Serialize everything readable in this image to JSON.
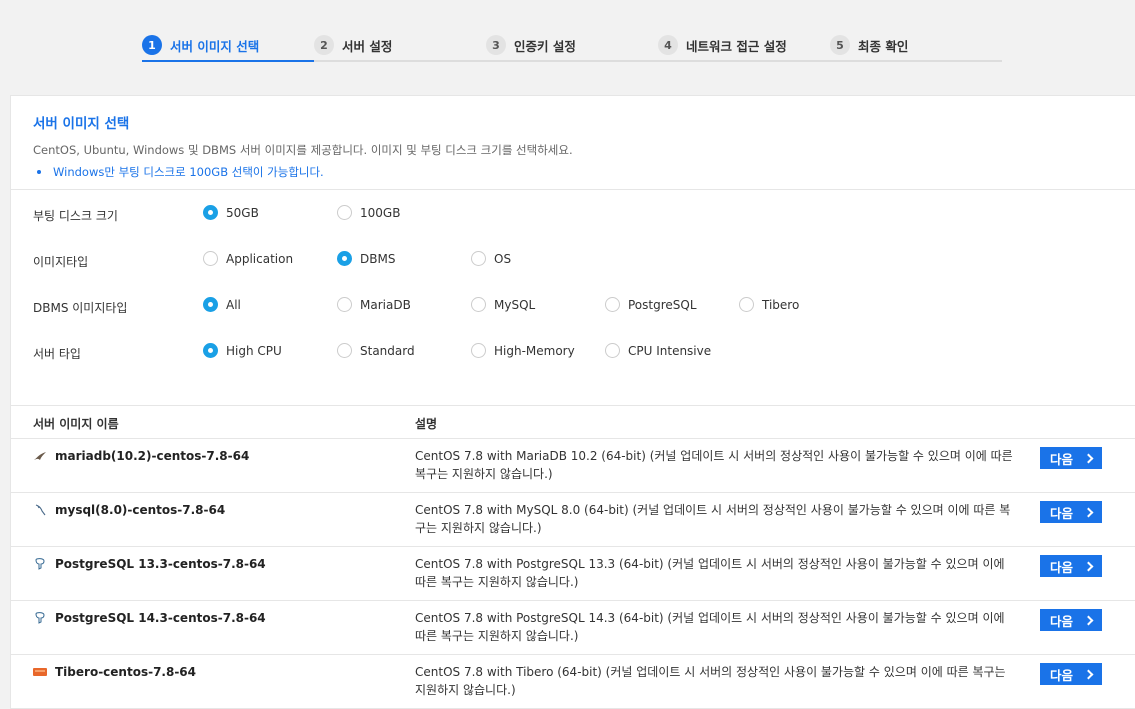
{
  "steps": [
    {
      "num": "1",
      "label": "서버 이미지 선택"
    },
    {
      "num": "2",
      "label": "서버 설정"
    },
    {
      "num": "3",
      "label": "인증키 설정"
    },
    {
      "num": "4",
      "label": "네트워크 접근 설정"
    },
    {
      "num": "5",
      "label": "최종 확인"
    }
  ],
  "intro": {
    "title": "서버 이미지 선택",
    "desc": "CentOS, Ubuntu, Windows 및 DBMS 서버 이미지를 제공합니다. 이미지 및 부팅 디스크 크기를 선택하세요.",
    "note": "Windows만 부팅 디스크로 100GB 선택이 가능합니다."
  },
  "options": {
    "boot_disk": {
      "label": "부팅 디스크 크기",
      "choices": [
        "50GB",
        "100GB"
      ],
      "selected": "50GB"
    },
    "image_type": {
      "label": "이미지타입",
      "choices": [
        "Application",
        "DBMS",
        "OS"
      ],
      "selected": "DBMS"
    },
    "dbms_type": {
      "label": "DBMS 이미지타입",
      "choices": [
        "All",
        "MariaDB",
        "MySQL",
        "PostgreSQL",
        "Tibero"
      ],
      "selected": "All"
    },
    "server_type": {
      "label": "서버 타입",
      "choices": [
        "High CPU",
        "Standard",
        "High-Memory",
        "CPU Intensive"
      ],
      "selected": "High CPU"
    }
  },
  "table": {
    "col_name": "서버 이미지 이름",
    "col_desc": "설명",
    "next_label": "다음",
    "rows": [
      {
        "icon": "mariadb-icon",
        "name": "mariadb(10.2)-centos-7.8-64",
        "desc": "CentOS 7.8 with MariaDB 10.2 (64-bit) (커널 업데이트 시 서버의 정상적인 사용이 불가능할 수 있으며 이에 따른 복구는 지원하지 않습니다.)"
      },
      {
        "icon": "mysql-icon",
        "name": "mysql(8.0)-centos-7.8-64",
        "desc": "CentOS 7.8 with MySQL 8.0 (64-bit) (커널 업데이트 시 서버의 정상적인 사용이 불가능할 수 있으며 이에 따른 복구는 지원하지 않습니다.)"
      },
      {
        "icon": "postgresql-icon",
        "name": "PostgreSQL 13.3-centos-7.8-64",
        "desc": "CentOS 7.8 with PostgreSQL 13.3 (64-bit) (커널 업데이트 시 서버의 정상적인 사용이 불가능할 수 있으며 이에 따른 복구는 지원하지 않습니다.)"
      },
      {
        "icon": "postgresql-icon",
        "name": "PostgreSQL 14.3-centos-7.8-64",
        "desc": "CentOS 7.8 with PostgreSQL 14.3 (64-bit) (커널 업데이트 시 서버의 정상적인 사용이 불가능할 수 있으며 이에 따른 복구는 지원하지 않습니다.)"
      },
      {
        "icon": "tibero-icon",
        "name": "Tibero-centos-7.8-64",
        "desc": "CentOS 7.8 with Tibero (64-bit) (커널 업데이트 시 서버의 정상적인 사용이 불가능할 수 있으며 이에 따른 복구는 지원하지 않습니다.)"
      }
    ]
  },
  "colors": {
    "accent": "#1a73e8",
    "radio_checked": "#1aa0e6"
  }
}
